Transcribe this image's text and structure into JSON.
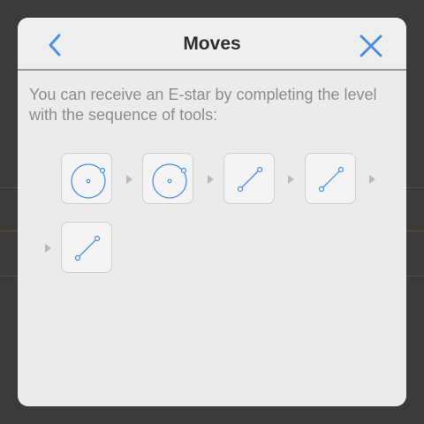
{
  "dialog": {
    "title": "Moves",
    "description": "You can receive an E-star by completing the level with the sequence of tools:",
    "back_icon": "chevron-left-icon",
    "close_icon": "close-icon",
    "accent_color": "#4a90e2"
  },
  "tools": [
    {
      "name": "circle",
      "icon": "circle-tool-icon"
    },
    {
      "name": "circle",
      "icon": "circle-tool-icon"
    },
    {
      "name": "line",
      "icon": "line-tool-icon"
    },
    {
      "name": "line",
      "icon": "line-tool-icon"
    },
    {
      "name": "line",
      "icon": "line-tool-icon"
    }
  ]
}
